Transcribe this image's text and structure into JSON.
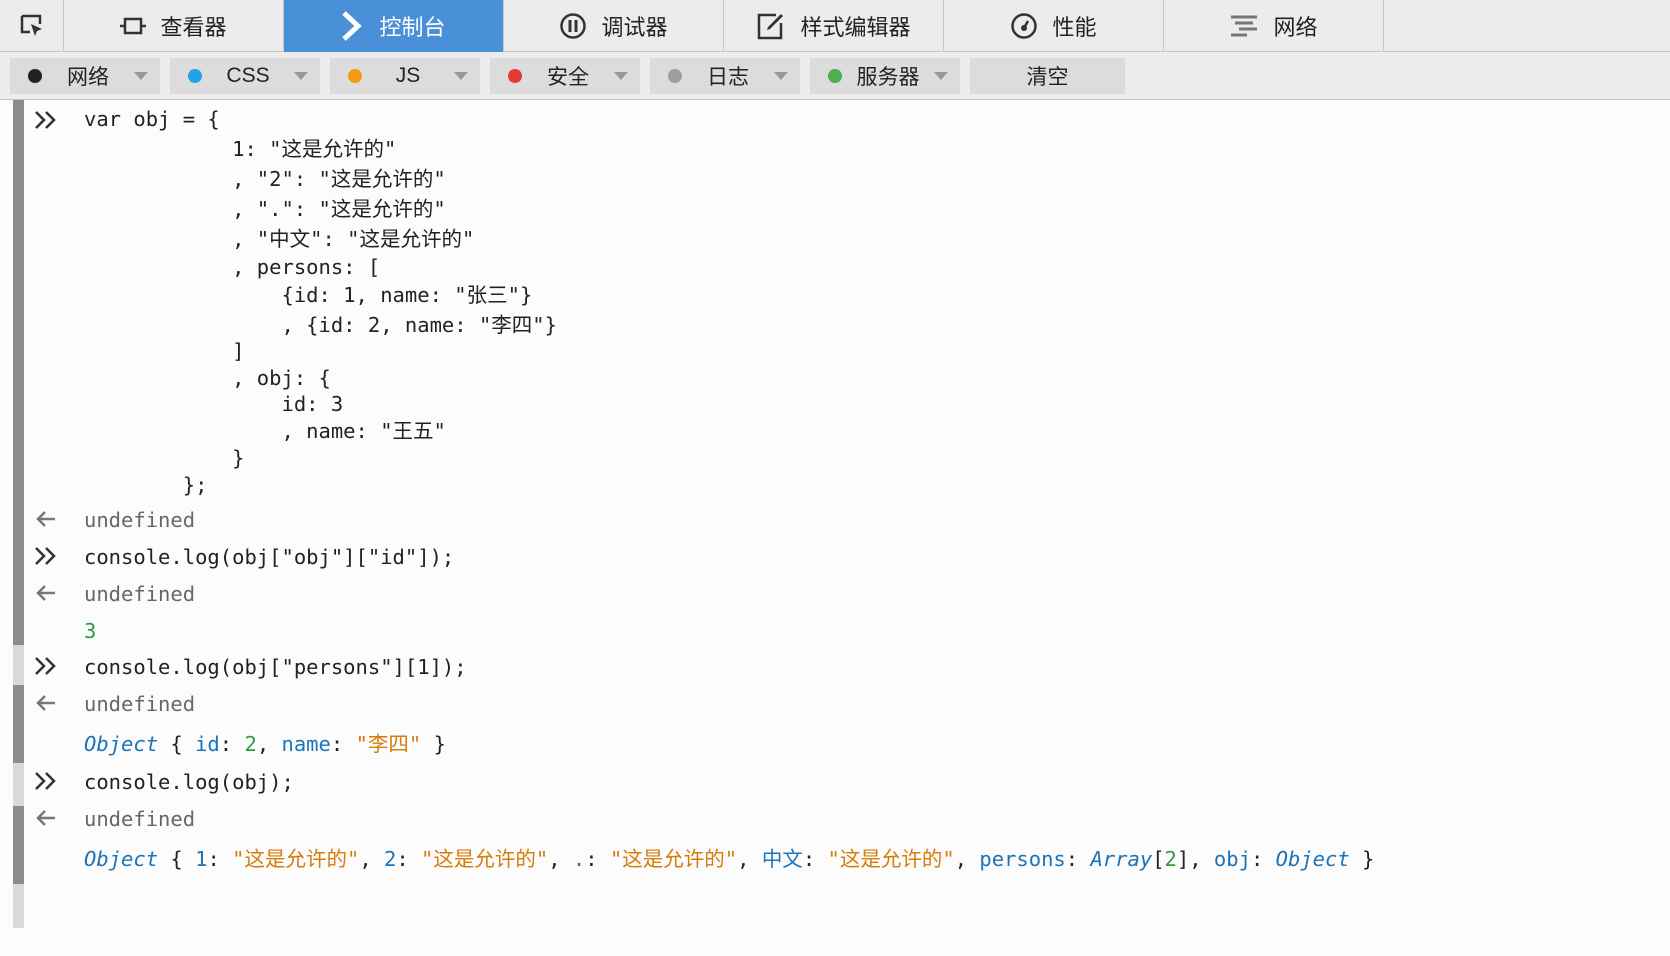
{
  "toolbar": {
    "tabs": [
      {
        "label": "查看器",
        "icon": "inspector-icon"
      },
      {
        "label": "控制台",
        "icon": "console-icon",
        "active": true
      },
      {
        "label": "调试器",
        "icon": "debugger-icon"
      },
      {
        "label": "样式编辑器",
        "icon": "style-editor-icon"
      },
      {
        "label": "性能",
        "icon": "performance-icon"
      },
      {
        "label": "网络",
        "icon": "network-icon"
      }
    ]
  },
  "filters": {
    "items": [
      {
        "label": "网络",
        "color": "#222222"
      },
      {
        "label": "CSS",
        "color": "#1fa3e6"
      },
      {
        "label": "JS",
        "color": "#f39c12"
      },
      {
        "label": "安全",
        "color": "#e53935"
      },
      {
        "label": "日志",
        "color": "#9e9e9e"
      },
      {
        "label": "服务器",
        "color": "#4caf50"
      }
    ],
    "clear_label": "清空"
  },
  "console": {
    "input1": [
      "var obj = {",
      "            1: \"这是允许的\"",
      "            , \"2\": \"这是允许的\"",
      "            , \".\": \"这是允许的\"",
      "            , \"中文\": \"这是允许的\"",
      "            , persons: [",
      "                {id: 1, name: \"张三\"}",
      "                , {id: 2, name: \"李四\"}",
      "            ]",
      "            , obj: {",
      "                id: 3",
      "                , name: \"王五\"",
      "            }",
      "        };"
    ],
    "result1": "undefined",
    "input2": "console.log(obj[\"obj\"][\"id\"]);",
    "result2": "undefined",
    "log2": "3",
    "input3": "console.log(obj[\"persons\"][1]);",
    "result3": "undefined",
    "log3": {
      "object": "Object",
      "open": " { ",
      "k1": "id",
      "sep1": ": ",
      "v1": "2",
      "comma1": ", ",
      "k2": "name",
      "sep2": ": ",
      "v2": "\"李四\"",
      "close": " }"
    },
    "input4": "console.log(obj);",
    "result4": "undefined",
    "log4": {
      "object": "Object",
      "open": " { ",
      "k1": "1",
      "v1": "\"这是允许的\"",
      "k2": "2",
      "v2": "\"这是允许的\"",
      "k3": ".",
      "v3": "\"这是允许的\"",
      "k4": "中文",
      "v4": "\"这是允许的\"",
      "k5": "persons",
      "array": "Array",
      "lb": "[",
      "arrlen": "2",
      "rb": "]",
      "k6": "obj",
      "v6": "Object",
      "sep": ": ",
      "comma": ", ",
      "close": " }"
    }
  }
}
